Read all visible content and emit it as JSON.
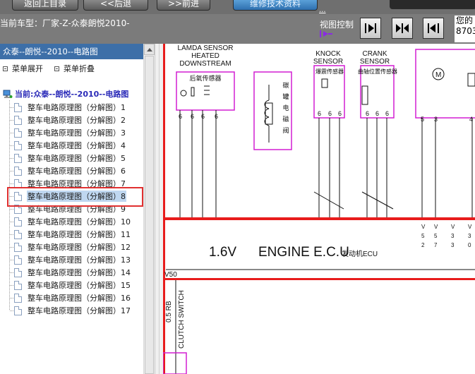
{
  "top_nav": {
    "buttons": [
      "返回上目录",
      "<<后退",
      ">>前进",
      "维修技术资料",
      ""
    ],
    "link": "..."
  },
  "header": {
    "current_model": "当前车型：厂家-Z-众泰朗悦2010-",
    "view_control_label": "视图控制",
    "right_text_line1": "您的",
    "right_text_line2": "8703"
  },
  "colors": {
    "panel_title_bg": "#3d6fa8",
    "header_bg": "#7b7b7b",
    "highlight_box": "#e03030",
    "diagram_red": "#e81c1c",
    "diagram_magenta": "#d21ed2"
  },
  "sidebar": {
    "title": "众泰--朗悦--2010--电路图",
    "expand_label": "菜单展开",
    "collapse_label": "菜单折叠",
    "root_label": "当前:众泰--朗悦--2010--电路图",
    "selected_index": 7,
    "items": [
      {
        "label": "整车电路原理图（分解图）1"
      },
      {
        "label": "整车电路原理图（分解图）2"
      },
      {
        "label": "整车电路原理图（分解图）3"
      },
      {
        "label": "整车电路原理图（分解图）4"
      },
      {
        "label": "整车电路原理图（分解图）5"
      },
      {
        "label": "整车电路原理图（分解图）6"
      },
      {
        "label": "整车电路原理图（分解图）7"
      },
      {
        "label": "整车电路原理图（分解图）8"
      },
      {
        "label": "整车电路原理图（分解图）9"
      },
      {
        "label": "整车电路原理图（分解图）10"
      },
      {
        "label": "整车电路原理图（分解图）11"
      },
      {
        "label": "整车电路原理图（分解图）12"
      },
      {
        "label": "整车电路原理图（分解图）13"
      },
      {
        "label": "整车电路原理图（分解图）14"
      },
      {
        "label": "整车电路原理图（分解图）15"
      },
      {
        "label": "整车电路原理图（分解图）16"
      },
      {
        "label": "整车电路原理图（分解图）17"
      }
    ]
  },
  "diagram": {
    "lamda_l1": "LAMDA SENSOR",
    "lamda_l2": "HEATED",
    "lamda_l3": "DOWNSTREAM",
    "lamda_cn": "后氧传感器",
    "canister_cn": [
      "碳",
      "罐",
      "电",
      "磁",
      "阀"
    ],
    "knock_l1": "KNOCK",
    "knock_l2": "SENSOR",
    "knock_cn": "爆震传感器",
    "crank_l1": "CRANK",
    "crank_l2": "SENSOR",
    "crank_cn": "曲轴位置传感器",
    "pin6": "6",
    "pin5": "5",
    "pin3": "3",
    "pin4": "4",
    "pin7": "7",
    "pin2": "2",
    "pin0": "0",
    "pinV": "V",
    "ecu_volt": "1.6V",
    "ecu_label": "ENGINE E.C.U",
    "ecu_cn": "发动机ECU",
    "v50": "V50",
    "wire_size": "0.5 RB",
    "clutch": "CLUTCH SWITCH"
  }
}
